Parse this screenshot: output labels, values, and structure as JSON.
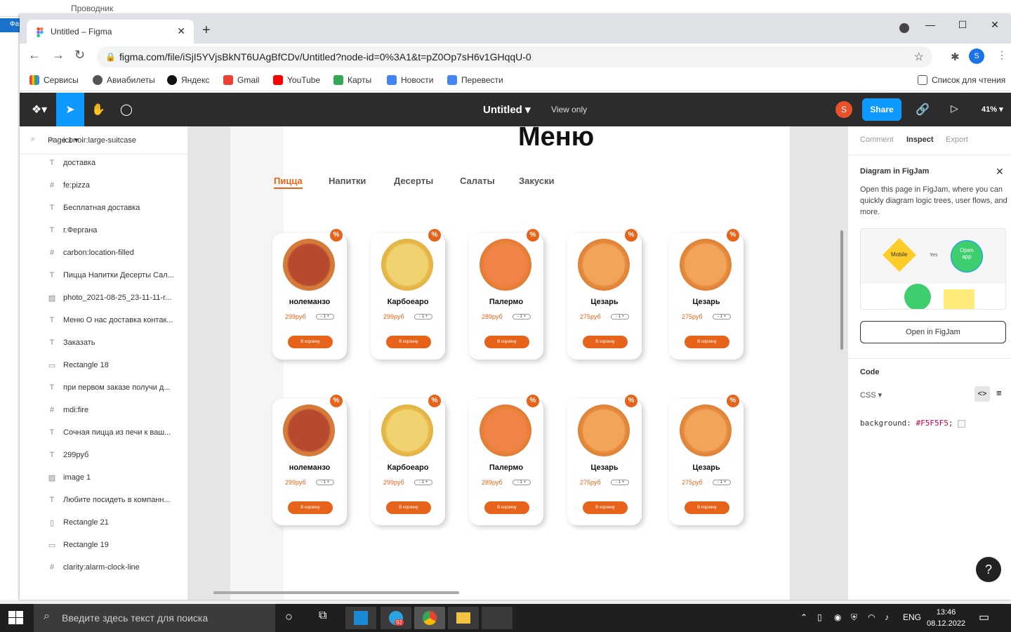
{
  "explorer": {
    "title": "Проводник",
    "tab_label": "Фа"
  },
  "browser": {
    "tab_title": "Untitled – Figma",
    "url": "figma.com/file/iSjI5YVjsBkNT6UAgBfCDv/Untitled?node-id=0%3A1&t=pZ0Op7sH6v1GHqqU-0",
    "profile_initial": "S",
    "bookmarks": [
      "Сервисы",
      "Авиабилеты",
      "Яндекс",
      "Gmail",
      "YouTube",
      "Карты",
      "Новости",
      "Перевести"
    ],
    "reading_list": "Список для чтения"
  },
  "figma": {
    "title": "Untitled",
    "view_only": "View only",
    "avatar": "S",
    "share": "Share",
    "zoom": "41%",
    "page": "Page 1",
    "layers": [
      {
        "icon": "#",
        "name": "iconoir:large-suitcase"
      },
      {
        "icon": "T",
        "name": "доставка"
      },
      {
        "icon": "#",
        "name": "fe:pizza"
      },
      {
        "icon": "T",
        "name": "Бесплатная доставка"
      },
      {
        "icon": "T",
        "name": "г.Фергана"
      },
      {
        "icon": "#",
        "name": "carbon:location-filled"
      },
      {
        "icon": "T",
        "name": "Пицца Напитки Десерты Сал..."
      },
      {
        "icon": "▨",
        "name": "photo_2021-08-25_23-11-11-r..."
      },
      {
        "icon": "T",
        "name": "Меню О нас доставка контак..."
      },
      {
        "icon": "T",
        "name": "Заказать"
      },
      {
        "icon": "▭",
        "name": "Rectangle 18"
      },
      {
        "icon": "T",
        "name": "при первом заказе получи д..."
      },
      {
        "icon": "#",
        "name": "mdi:fire"
      },
      {
        "icon": "T",
        "name": "Сочная пицца из печи к ваш..."
      },
      {
        "icon": "T",
        "name": "299руб"
      },
      {
        "icon": "▨",
        "name": "image 1"
      },
      {
        "icon": "T",
        "name": "Любите посидеть в компанн..."
      },
      {
        "icon": "▯",
        "name": "Rectangle 21"
      },
      {
        "icon": "▭",
        "name": "Rectangle 19"
      },
      {
        "icon": "#",
        "name": "clarity:alarm-clock-line"
      }
    ],
    "canvas": {
      "menu_title": "Меню",
      "categories": [
        "Пицца",
        "Напитки",
        "Десерты",
        "Салаты",
        "Закуски"
      ],
      "cart_label": "В корзину",
      "qty_label": "- 1 +",
      "row1": [
        {
          "name": "ноле­манзо",
          "price": "299руб"
        },
        {
          "name": "Карбоеаро",
          "price": "299руб"
        },
        {
          "name": "Палермо",
          "price": "289руб"
        },
        {
          "name": "Цезарь",
          "price": "275руб"
        },
        {
          "name": "Цезарь",
          "price": "275руб"
        }
      ],
      "row2": [
        {
          "name": "ноле­манзо",
          "price": "299руб"
        },
        {
          "name": "Карбоеаро",
          "price": "299руб"
        },
        {
          "name": "Палермо",
          "price": "289руб"
        },
        {
          "name": "Цезарь",
          "price": "275руб"
        },
        {
          "name": "Цезарь",
          "price": "275руб"
        }
      ]
    },
    "inspect": {
      "tabs": [
        "Comment",
        "Inspect",
        "Export"
      ],
      "figjam_title": "Diagram in FigJam",
      "figjam_desc": "Open this page in FigJam, where you can quickly diagram logic trees, user flows, and more.",
      "figjam_mobile": "Mobile",
      "figjam_yes": "Yes",
      "figjam_open": "Open app",
      "figjam_btn": "Open in FigJam",
      "code_title": "Code",
      "code_lang": "CSS",
      "code_prop": "background:",
      "code_value": "#F5F5F5",
      "code_end": ";"
    },
    "help": "?"
  },
  "taskbar": {
    "search_placeholder": "Введите здесь текст для поиска",
    "lang": "ENG",
    "time": "13:46",
    "date": "08.12.2022",
    "telegram_badge": "92"
  }
}
